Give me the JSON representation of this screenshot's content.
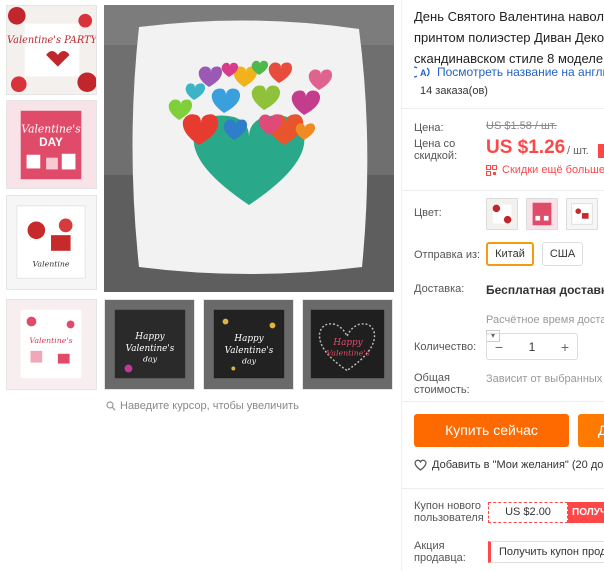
{
  "product": {
    "title_lines": [
      "День Святого Валентина навол",
      "принтом полиэстер Диван Деко",
      "скандинавском стиле 8 моделе"
    ],
    "translate_link": "Посмотреть название на английс",
    "orders": "14 заказа(ов)"
  },
  "price": {
    "label": "Цена:",
    "old": "US $1.58 / шт.",
    "discount_label_1": "Цена со",
    "discount_label_2": "скидкой:",
    "new": "US $1.26",
    "unit": "/ шт.",
    "more_discounts": "Скидки ещё больше"
  },
  "options": {
    "color_label": "Цвет:",
    "ship_from_label": "Отправка из:",
    "ship_from": [
      "Китай",
      "США"
    ],
    "delivery_label": "Доставка:",
    "free_delivery": "Бесплатная доставка в",
    "calc_time": "Расчётное время достав",
    "quantity_label": "Количество:",
    "quantity_value": "1",
    "total_label_1": "Общая",
    "total_label_2": "стоимость:",
    "total_note": "Зависит от выбранных з"
  },
  "actions": {
    "buy_now": "Купить сейчас",
    "add_cart": "Д",
    "wishlist": "Добавить в \"Мои желания\" (20 доб"
  },
  "coupons": {
    "new_user_label_1": "Купон нового",
    "new_user_label_2": "пользователя",
    "new_user_value": "US $2.00",
    "new_user_get": "ПОЛУЧ",
    "seller_label_1": "Акция",
    "seller_label_2": "продавца:",
    "seller_get": "Получить купон продав"
  },
  "gallery": {
    "zoom_hint": "Наведите курсор, чтобы увеличить",
    "thumb_texts": [
      "Valentine's PARTY",
      "Valentine's DAY",
      "Happy Valentine's day",
      "Happy Valentine's day",
      "Happy Valentine's day"
    ]
  },
  "colors": {
    "accent": "#ff4747",
    "buy": "#ff6a00",
    "link": "#2463c8",
    "selected_border": "#f39c12"
  }
}
